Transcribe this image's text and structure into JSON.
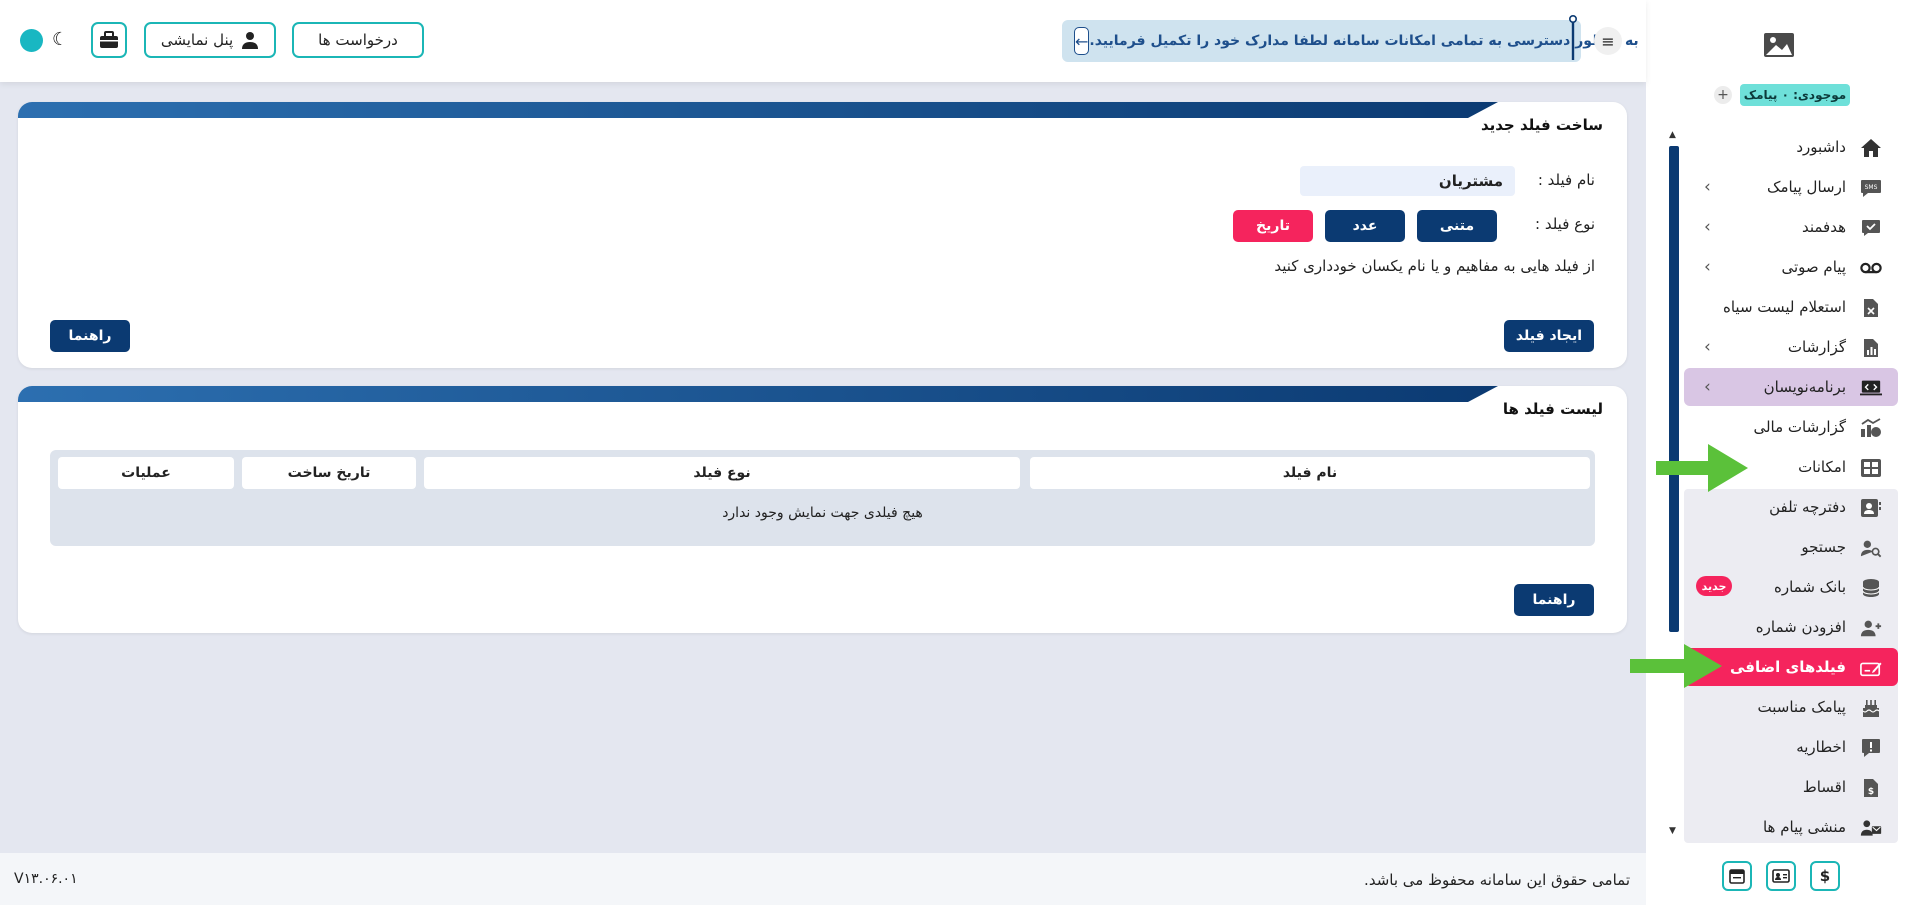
{
  "colors": {
    "navy": "#0b3a72",
    "teal": "#1bb6b6",
    "pink": "#f5245d",
    "purple_highlight": "#d9c6e4",
    "green_arrow": "#5bc13a"
  },
  "header": {
    "requests_label": "درخواست ها",
    "demo_panel_label": "پنل نمایشی",
    "notice": "به منظور دسترسی به تمامی امکانات سامانه لطفا مدارک خود را تکمیل فرمایید.",
    "icons": [
      "briefcase-icon",
      "user-icon",
      "moon-icon",
      "arrow-left-icon",
      "menu-icon"
    ]
  },
  "create_card": {
    "title": "ساخت فیلد جدید",
    "name_label": "نام فیلد :",
    "name_value": "مشتریان",
    "type_label": "نوع فیلد :",
    "types": {
      "text": "متنی",
      "number": "عدد",
      "date": "تاریخ"
    },
    "hint": "از فیلد هایی به مفاهیم و یا نام یکسان خودداری کنید",
    "create_button": "ایجاد فیلد",
    "help_button": "راهنما"
  },
  "list_card": {
    "title": "لیست فیلد ها",
    "columns": {
      "name": "نام فیلد",
      "type": "نوع فیلد",
      "created": "تاریخ ساخت",
      "ops": "عملیات"
    },
    "empty": "هیچ فیلدی جهت نمایش وجود ندارد",
    "help_button": "راهنما"
  },
  "footer": {
    "copyright": "تمامی حقوق این سامانه محفوظ می باشد.",
    "version": "V۱۳.۰۶.۰۱"
  },
  "sidebar": {
    "balance": "موجودی: ۰ پیامک",
    "items": [
      {
        "label": "داشبورد",
        "icon": "home-icon"
      },
      {
        "label": "ارسال پیامک",
        "icon": "sms-icon",
        "chevron": true
      },
      {
        "label": "هدفمند",
        "icon": "check-message-icon",
        "chevron": true
      },
      {
        "label": "پیام صوتی",
        "icon": "voicemail-icon",
        "chevron": true
      },
      {
        "label": "استعلام لیست سیاه",
        "icon": "blacklist-file-icon"
      },
      {
        "label": "گزارشات",
        "icon": "report-icon",
        "chevron": true
      },
      {
        "label": "برنامه‌نویسان",
        "icon": "code-icon",
        "chevron": true,
        "highlight": true
      },
      {
        "label": "گزارشات مالی",
        "icon": "finance-icon"
      },
      {
        "label": "امکانات",
        "icon": "features-icon"
      },
      {
        "label": "دفترچه تلفن",
        "icon": "phonebook-icon"
      },
      {
        "label": "جستجو",
        "icon": "user-search-icon"
      },
      {
        "label": "بانک شماره",
        "icon": "database-icon",
        "badge": "جدید"
      },
      {
        "label": "افزودن شماره",
        "icon": "add-user-icon"
      },
      {
        "label": "فیلدهای اضافی",
        "icon": "edit-field-icon",
        "active": true
      },
      {
        "label": "پیامک مناسبت",
        "icon": "cake-icon"
      },
      {
        "label": "اخطاریه",
        "icon": "warning-icon"
      },
      {
        "label": "اقساط",
        "icon": "installment-icon"
      },
      {
        "label": "منشی پیام ها",
        "icon": "secretary-icon"
      }
    ]
  }
}
